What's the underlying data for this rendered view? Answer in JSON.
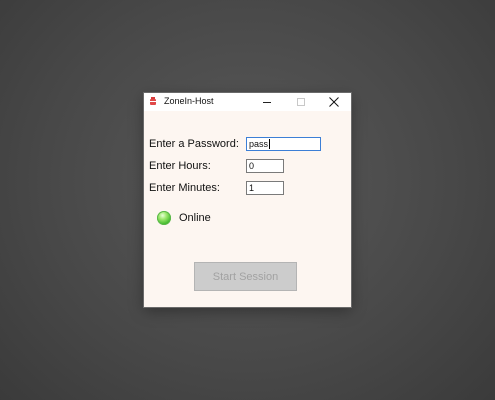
{
  "window": {
    "title": "ZoneIn-Host",
    "app_icon": "app-icon",
    "controls": {
      "minimize": "minimize-icon",
      "maximize": "maximize-icon",
      "close": "close-icon"
    }
  },
  "form": {
    "password": {
      "label": "Enter a Password:",
      "value": "pass"
    },
    "hours": {
      "label": "Enter Hours:",
      "value": "0"
    },
    "minutes": {
      "label": "Enter Minutes:",
      "value": "1"
    }
  },
  "status": {
    "text": "Online",
    "icon": "status-online-icon",
    "color": "#4cc236"
  },
  "actions": {
    "start_label": "Start Session",
    "start_enabled": false
  },
  "colors": {
    "window_background": "#fdf6f1",
    "desktop_background": "#4a4a4a",
    "focused_field_border": "#3c7fd6"
  }
}
